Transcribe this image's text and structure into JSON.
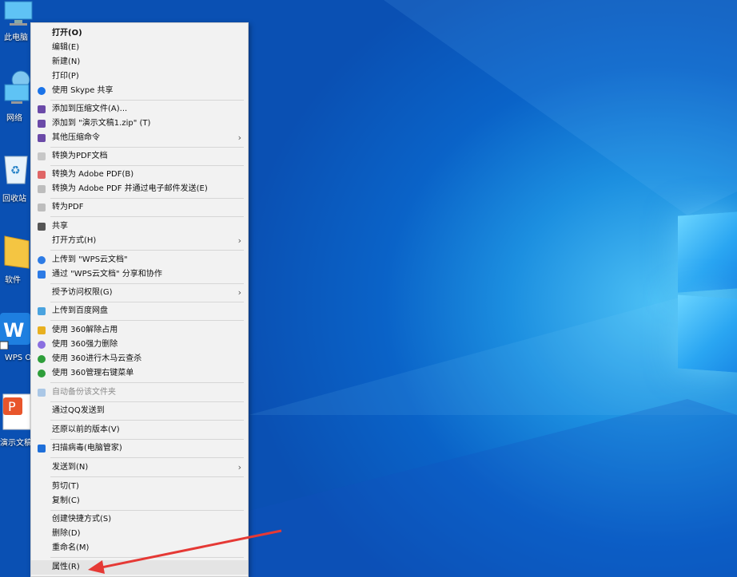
{
  "desktop_icons": [
    {
      "label": "此电脑",
      "icon": "this-pc-icon"
    },
    {
      "label": "网络",
      "icon": "network-icon"
    },
    {
      "label": "回收站",
      "icon": "recycle-bin-icon"
    },
    {
      "label": "软件",
      "icon": "folder-icon"
    },
    {
      "label": "WPS Off",
      "icon": "wps-office-icon"
    },
    {
      "label": "演示文稿",
      "icon": "wps-presentation-icon"
    }
  ],
  "menu": {
    "items": [
      "打开(O)",
      "编辑(E)",
      "新建(N)",
      "打印(P)",
      "使用 Skype 共享",
      "添加到压缩文件(A)...",
      "添加到 \"演示文稿1.zip\" (T)",
      "其他压缩命令",
      "转换为PDF文档",
      "转换为 Adobe PDF(B)",
      "转换为 Adobe PDF 并通过电子邮件发送(E)",
      "转为PDF",
      "共享",
      "打开方式(H)",
      "上传到 \"WPS云文档\"",
      "通过 \"WPS云文档\" 分享和协作",
      "授予访问权限(G)",
      "上传到百度网盘",
      "使用 360解除占用",
      "使用 360强力删除",
      "使用 360进行木马云查杀",
      "使用 360管理右键菜单",
      "自动备份该文件夹",
      "通过QQ发送到",
      "还原以前的版本(V)",
      "扫描病毒(电脑管家)",
      "发送到(N)",
      "剪切(T)",
      "复制(C)",
      "创建快捷方式(S)",
      "删除(D)",
      "重命名(M)",
      "属性(R)"
    ]
  },
  "colors": {
    "desktop": "#0a63c8",
    "menu_bg": "#f2f2f2",
    "arrow": "#e53935"
  }
}
